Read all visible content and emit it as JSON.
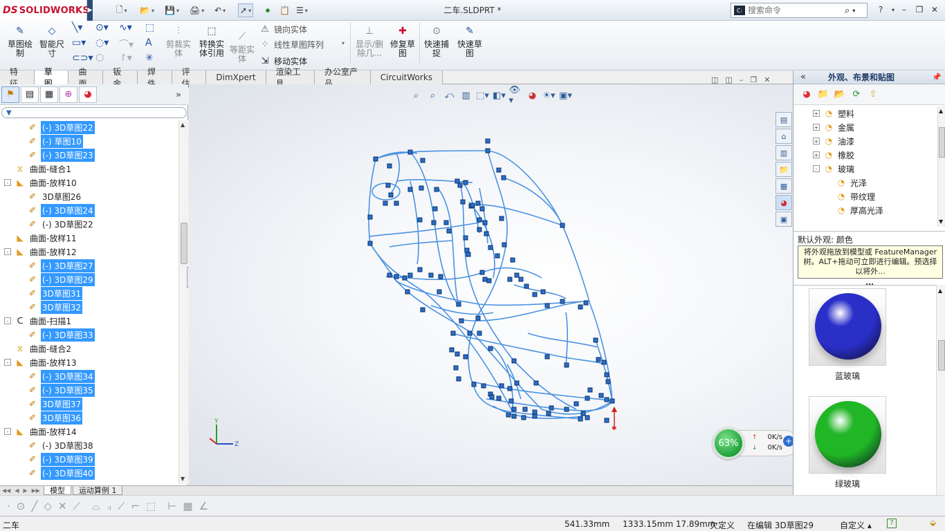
{
  "app": {
    "logo_ds": "DS",
    "logo_text": "SOLIDWORKS",
    "document_title": "二车.SLDPRT *"
  },
  "search": {
    "placeholder": "搜索命令",
    "value": "搜索命令"
  },
  "commands": {
    "sketch": "草图绘\n制",
    "smart_dimension": "智能尺\n寸",
    "trim": "剪裁实\n体",
    "convert": "转换实\n体引用",
    "offset": "等距实\n体",
    "mirror": "镜向实体",
    "linear_pattern": "线性草图阵列",
    "move": "移动实体",
    "show_delete": "显示/删\n除几...",
    "repair": "修复草\n图",
    "quick_snaps": "快速捕\n捉",
    "rapid_sketch": "快速草\n图"
  },
  "tabs": [
    "特征",
    "草图",
    "曲面",
    "钣金",
    "焊件",
    "评估",
    "DimXpert",
    "渲染工具",
    "办公室产品",
    "CircuitWorks"
  ],
  "active_tab": "草图",
  "tree": [
    {
      "label": "(-) 3D草图22",
      "type": "sk",
      "indent": 1,
      "sel": true
    },
    {
      "label": "(-) 草图10",
      "type": "sk",
      "indent": 1,
      "sel": true
    },
    {
      "label": "(-) 3D草图23",
      "type": "sk",
      "indent": 1,
      "sel": true
    },
    {
      "label": "曲面-缝合1",
      "type": "kn",
      "indent": 0,
      "sel": false
    },
    {
      "label": "曲面-放样10",
      "type": "sf",
      "indent": 0,
      "sel": false,
      "exp": "-"
    },
    {
      "label": "3D草图26",
      "type": "sk",
      "indent": 1,
      "sel": false
    },
    {
      "label": "(-) 3D草图24",
      "type": "sk",
      "indent": 1,
      "sel": true
    },
    {
      "label": "(-) 3D草图22",
      "type": "sk",
      "indent": 1,
      "sel": false
    },
    {
      "label": "曲面-放样11",
      "type": "sf",
      "indent": 0,
      "sel": false
    },
    {
      "label": "曲面-放样12",
      "type": "sf",
      "indent": 0,
      "sel": false,
      "exp": "-"
    },
    {
      "label": "(-) 3D草图27",
      "type": "sk",
      "indent": 1,
      "sel": true
    },
    {
      "label": "(-) 3D草图29",
      "type": "sk",
      "indent": 1,
      "sel": true
    },
    {
      "label": "3D草图31",
      "type": "sk",
      "indent": 1,
      "sel": true
    },
    {
      "label": "3D草图32",
      "type": "sk",
      "indent": 1,
      "sel": true
    },
    {
      "label": "曲面-扫描1",
      "type": "sw",
      "indent": 0,
      "sel": false,
      "exp": "-"
    },
    {
      "label": "(-) 3D草图33",
      "type": "sk",
      "indent": 1,
      "sel": true
    },
    {
      "label": "曲面-缝合2",
      "type": "kn",
      "indent": 0,
      "sel": false
    },
    {
      "label": "曲面-放样13",
      "type": "sf",
      "indent": 0,
      "sel": false,
      "exp": "-"
    },
    {
      "label": "(-) 3D草图34",
      "type": "sk",
      "indent": 1,
      "sel": true
    },
    {
      "label": "(-) 3D草图35",
      "type": "sk",
      "indent": 1,
      "sel": true
    },
    {
      "label": "3D草图37",
      "type": "sk",
      "indent": 1,
      "sel": true
    },
    {
      "label": "3D草图36",
      "type": "sk",
      "indent": 1,
      "sel": true
    },
    {
      "label": "曲面-放样14",
      "type": "sf",
      "indent": 0,
      "sel": false,
      "exp": "-"
    },
    {
      "label": "(-) 3D草图38",
      "type": "sk",
      "indent": 1,
      "sel": false
    },
    {
      "label": "(-) 3D草图39",
      "type": "sk",
      "indent": 1,
      "sel": true
    },
    {
      "label": "(-) 3D草图40",
      "type": "sk",
      "indent": 1,
      "sel": true
    }
  ],
  "bottom_tabs": [
    "模型",
    "运动算例 1"
  ],
  "net": {
    "percent": "63%",
    "up": "0K/s",
    "down": "0K/s"
  },
  "right_panel": {
    "title": "外观、布景和贴图",
    "tree": [
      {
        "label": "塑料",
        "indent": 0,
        "exp": "+"
      },
      {
        "label": "金属",
        "indent": 0,
        "exp": "+"
      },
      {
        "label": "油漆",
        "indent": 0,
        "exp": "+"
      },
      {
        "label": "橡胶",
        "indent": 0,
        "exp": "+"
      },
      {
        "label": "玻璃",
        "indent": 0,
        "exp": "-"
      },
      {
        "label": "光泽",
        "indent": 1
      },
      {
        "label": "带纹理",
        "indent": 1
      },
      {
        "label": "厚高光泽",
        "indent": 1
      }
    ],
    "default_appearance": "默认外观: 颜色",
    "tooltip": "将外观拖放到模型或 FeatureManager 树。ALT+拖动可立即进行编辑。预选择以将外...",
    "swatches": [
      {
        "label": "蓝玻璃",
        "color": "#2a2fc8"
      },
      {
        "label": "绿玻璃",
        "color": "#21b626"
      }
    ]
  },
  "status": {
    "doc": "二车",
    "x": "541.33mm",
    "yz": "1333.15mm 17.89mm",
    "defined": "欠定义",
    "editing": "在编辑 3D草图29",
    "custom": "自定义"
  },
  "colors": {
    "selection": "#3399ff",
    "sketch": "#3d8fe0",
    "accent": "#c8102e"
  }
}
